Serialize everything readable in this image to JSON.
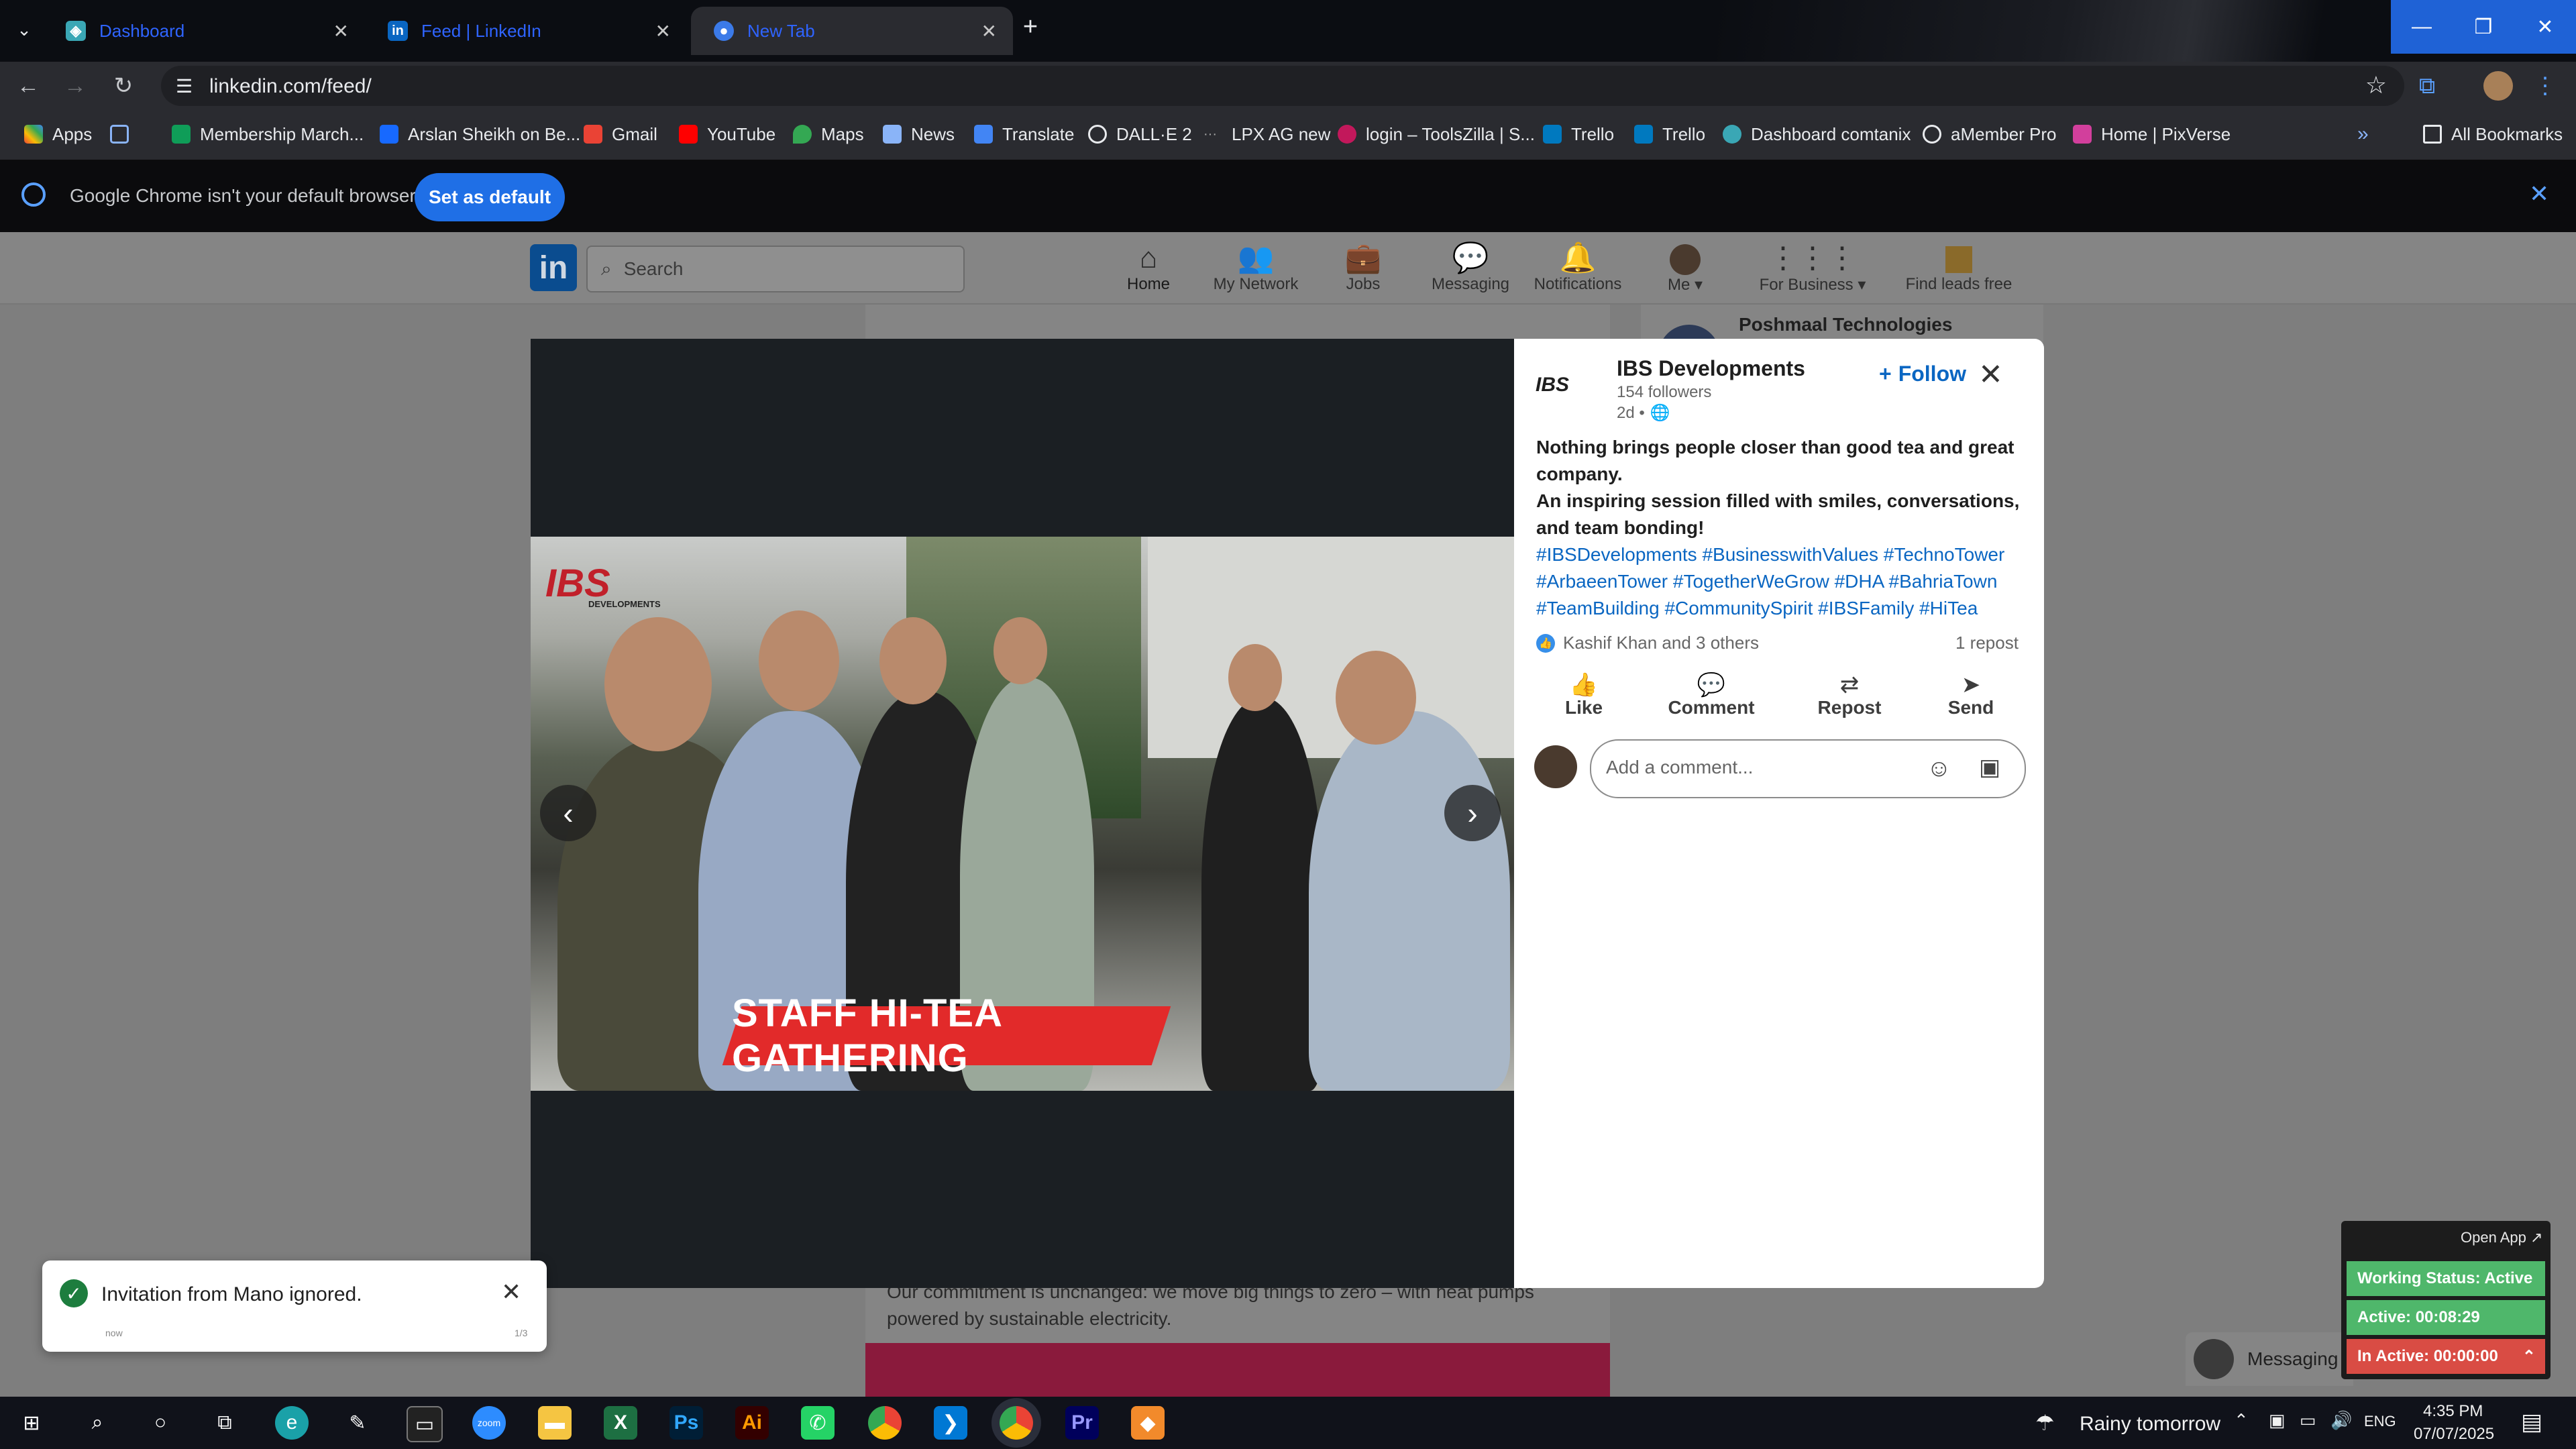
{
  "browser": {
    "tabs": [
      {
        "title": "Dashboard",
        "favicon": "dashboard-icon",
        "active": false
      },
      {
        "title": "Feed | LinkedIn",
        "favicon": "linkedin-icon",
        "active": false
      },
      {
        "title": "New Tab",
        "favicon": "chrome-icon",
        "active": true
      }
    ],
    "url": "linkedin.com/feed/",
    "bookmarks": [
      {
        "label": "Apps",
        "icon": "apps-grid-icon"
      },
      {
        "label": "",
        "icon": "tab-groups-icon"
      },
      {
        "label": "Membership March...",
        "icon": "sheets-icon"
      },
      {
        "label": "Arslan Sheikh on Be...",
        "icon": "behance-icon"
      },
      {
        "label": "Gmail",
        "icon": "gmail-icon"
      },
      {
        "label": "YouTube",
        "icon": "youtube-icon"
      },
      {
        "label": "Maps",
        "icon": "maps-icon"
      },
      {
        "label": "News",
        "icon": "news-icon"
      },
      {
        "label": "Translate",
        "icon": "translate-icon"
      },
      {
        "label": "DALL·E 2",
        "icon": "openai-icon"
      },
      {
        "label": "LPX AG new",
        "icon": "dots-icon"
      },
      {
        "label": "login – ToolsZilla | S...",
        "icon": "toolszilla-icon"
      },
      {
        "label": "Trello",
        "icon": "trello-icon"
      },
      {
        "label": "Trello",
        "icon": "trello-icon"
      },
      {
        "label": "Dashboard comtanix",
        "icon": "dashboard-icon"
      },
      {
        "label": "aMember Pro",
        "icon": "amember-icon"
      },
      {
        "label": "Home | PixVerse",
        "icon": "pixverse-icon"
      }
    ],
    "all_bookmarks": "All Bookmarks",
    "infobar": {
      "message": "Google Chrome isn't your default browser",
      "button": "Set as default"
    }
  },
  "linkedin": {
    "logo": "in",
    "search_placeholder": "Search",
    "nav": [
      {
        "label": "Home",
        "icon": "home-icon",
        "active": true
      },
      {
        "label": "My Network",
        "icon": "network-icon"
      },
      {
        "label": "Jobs",
        "icon": "jobs-icon"
      },
      {
        "label": "Messaging",
        "icon": "messaging-icon"
      },
      {
        "label": "Notifications",
        "icon": "bell-icon"
      },
      {
        "label": "Me",
        "icon": "avatar"
      },
      {
        "label": "For Business",
        "icon": "grid-icon"
      },
      {
        "label": "Find leads free",
        "icon": "leads-icon"
      }
    ],
    "background_company": "Poshmaal Technologies",
    "background_post_text": [
      "Our commitment is unchanged: we move big things to zero – with heat pumps",
      "powered by sustainable electricity."
    ],
    "messaging_label": "Messaging"
  },
  "post": {
    "image_brand": "IBS",
    "image_brand_sub": "DEVELOPMENTS",
    "image_banner": "STAFF HI-TEA GATHERING",
    "author": "IBS Developments",
    "author_logo": "IBS",
    "followers": "154 followers",
    "age": "2d •",
    "follow_label": "Follow",
    "text_lines": [
      "Nothing brings people closer than good tea and great",
      "company.",
      "An inspiring session filled with smiles, conversations,",
      "and team bonding!"
    ],
    "hashtag_lines": [
      "#IBSDevelopments #BusinesswithValues #TechnoTower",
      "#ArbaeenTower #TogetherWeGrow #DHA #BahriaTown",
      "#TeamBuilding #CommunitySpirit #IBSFamily #HiTea"
    ],
    "reactions": "Kashif Khan and 3 others",
    "reposts": "1 repost",
    "actions": [
      {
        "label": "Like",
        "icon": "like-icon"
      },
      {
        "label": "Comment",
        "icon": "comment-icon"
      },
      {
        "label": "Repost",
        "icon": "repost-icon"
      },
      {
        "label": "Send",
        "icon": "send-icon"
      }
    ],
    "comment_placeholder": "Add a comment..."
  },
  "toast": {
    "message": "Invitation from Mano ignored.",
    "time": "now",
    "counter": "1/3"
  },
  "tracker": {
    "open_app": "Open App ↗",
    "working_status": "Working Status: Active",
    "active": "Active: 00:08:29",
    "inactive": "In Active: 00:00:00",
    "colors": {
      "working": "#4fb76b",
      "active": "#4fb76b",
      "inactive": "#d94c44"
    }
  },
  "taskbar": {
    "weather": "Rainy tomorrow",
    "language": "ENG",
    "time": "4:35 PM",
    "date": "07/07/2025",
    "apps": [
      "windows-start-icon",
      "search-icon",
      "cortana-icon",
      "task-view-icon",
      "edge-icon",
      "pen-icon",
      "terminal-icon",
      "zoom-icon",
      "file-explorer-icon",
      "excel-icon",
      "photoshop-icon",
      "illustrator-icon",
      "phone-icon",
      "chrome-icon",
      "vscode-icon",
      "chrome-active-icon",
      "premiere-icon",
      "app-icon"
    ]
  }
}
